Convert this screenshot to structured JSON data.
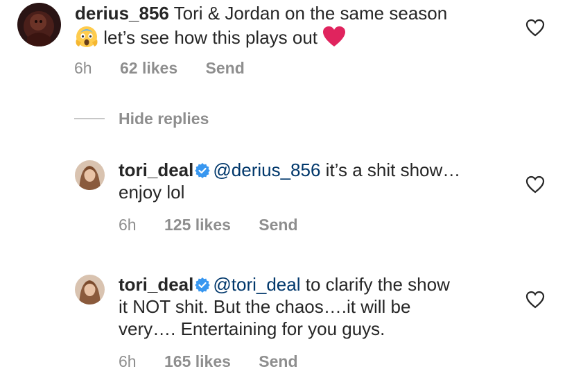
{
  "comments": [
    {
      "username": "derius_856",
      "verified": false,
      "mention": "",
      "text_line1": "Tori & Jordan on the same season",
      "text_line2": "let’s see how this plays out",
      "time": "6h",
      "likes": "62 likes",
      "send": "Send"
    },
    {
      "username": "tori_deal",
      "verified": true,
      "mention": "@derius_856",
      "text_line1": "it’s a shit show…",
      "text_line2": "enjoy lol",
      "time": "6h",
      "likes": "125 likes",
      "send": "Send"
    },
    {
      "username": "tori_deal",
      "verified": true,
      "mention": "@tori_deal",
      "text_line1": "to clarify the show",
      "text_line2": "it NOT shit. But the chaos….it will be",
      "text_line3": "very…. Entertaining for you guys.",
      "time": "6h",
      "likes": "165 likes",
      "send": "Send"
    }
  ],
  "hide_replies_label": "Hide replies",
  "icons": {
    "heart": "heart-outline-icon",
    "verified": "verified-badge-icon",
    "emoji_scream": "face-screaming-emoji",
    "emoji_heart": "red-heart-emoji"
  },
  "colors": {
    "text": "#262626",
    "meta": "#8e8e8e",
    "mention": "#00376b",
    "verified": "#3897f0",
    "heart_emoji": "#e0245e"
  }
}
